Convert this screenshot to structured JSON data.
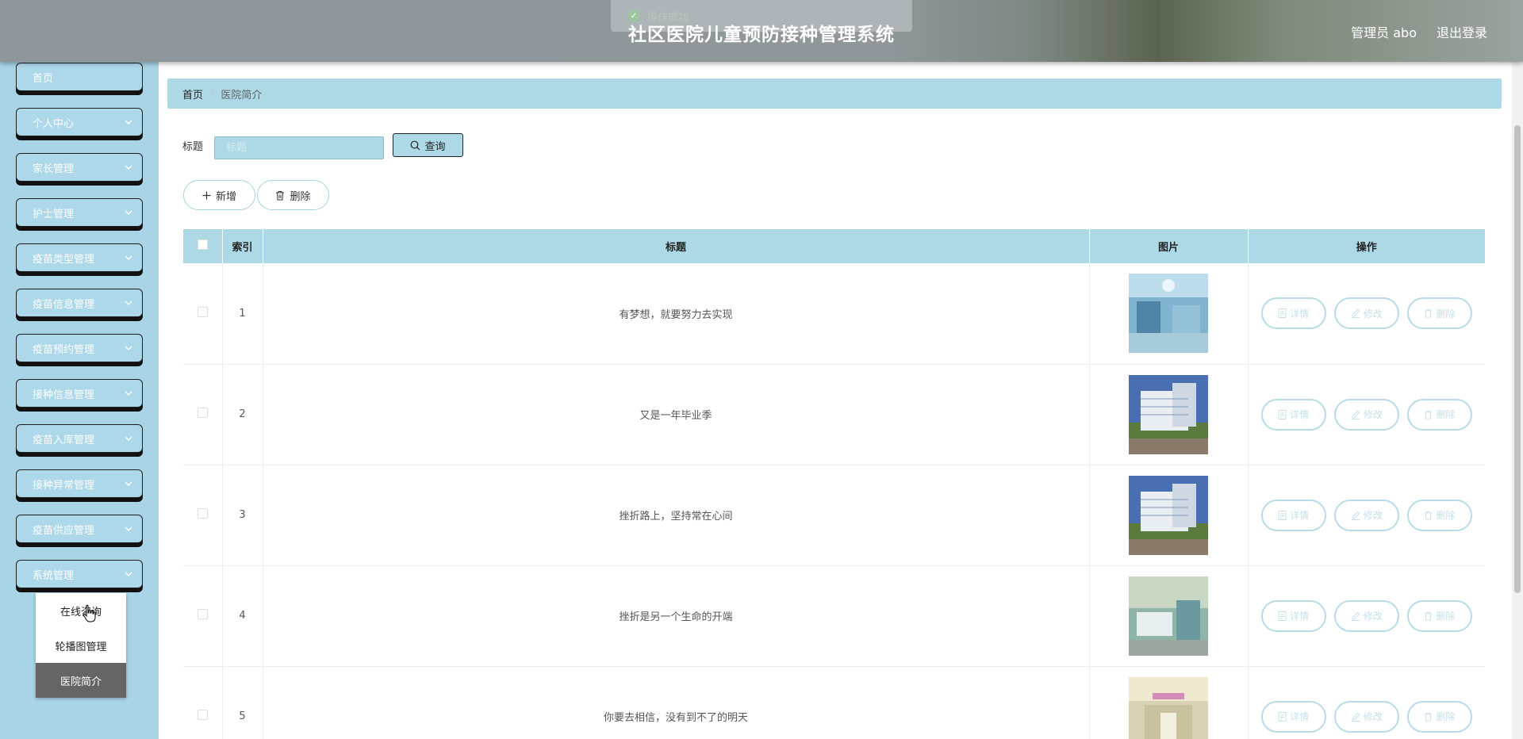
{
  "header": {
    "toast": "操作成功",
    "title": "社区医院儿童预防接种管理系统",
    "user": "管理员 abo",
    "logout": "退出登录"
  },
  "sidebar": {
    "items": [
      {
        "label": "首页"
      },
      {
        "label": "个人中心"
      },
      {
        "label": "家长管理"
      },
      {
        "label": "护士管理"
      },
      {
        "label": "疫苗类型管理"
      },
      {
        "label": "疫苗信息管理"
      },
      {
        "label": "疫苗预约管理"
      },
      {
        "label": "接种信息管理"
      },
      {
        "label": "疫苗入库管理"
      },
      {
        "label": "接种异常管理"
      },
      {
        "label": "疫苗供应管理"
      },
      {
        "label": "系统管理"
      }
    ],
    "submenu": [
      {
        "label": "在线咨询"
      },
      {
        "label": "轮播图管理"
      },
      {
        "label": "医院简介"
      }
    ]
  },
  "breadcrumb": {
    "home": "首页",
    "current": "医院简介"
  },
  "search": {
    "label": "标题",
    "placeholder": "标题",
    "button": "查询"
  },
  "actions": {
    "add": "新增",
    "delete": "删除"
  },
  "table": {
    "headers": {
      "index": "索引",
      "title": "标题",
      "image": "图片",
      "ops": "操作"
    },
    "ops": {
      "detail": "详情",
      "edit": "修改",
      "delete": "删除"
    },
    "rows": [
      {
        "index": "1",
        "title": "有梦想，就要努力去实现"
      },
      {
        "index": "2",
        "title": "又是一年毕业季"
      },
      {
        "index": "3",
        "title": "挫折路上，坚持常在心间"
      },
      {
        "index": "4",
        "title": "挫折是另一个生命的开端"
      },
      {
        "index": "5",
        "title": "你要去相信，没有到不了的明天"
      }
    ]
  },
  "colors": {
    "accent": "#add8e6",
    "sidebar": "#a8d4e6"
  }
}
